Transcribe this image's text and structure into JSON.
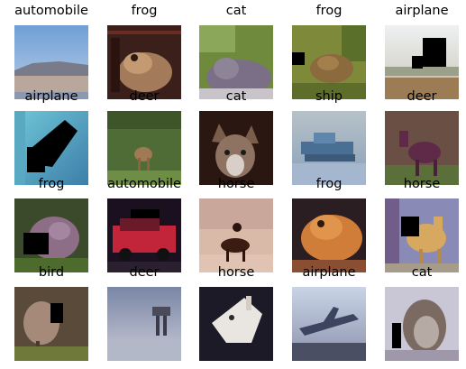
{
  "grid": {
    "rows": 4,
    "cols": 5,
    "images": [
      {
        "label": "automobile",
        "scene": "automobile-1"
      },
      {
        "label": "frog",
        "scene": "frog-1"
      },
      {
        "label": "cat",
        "scene": "cat-1"
      },
      {
        "label": "frog",
        "scene": "frog-2"
      },
      {
        "label": "airplane",
        "scene": "airplane-1"
      },
      {
        "label": "airplane",
        "scene": "airplane-2"
      },
      {
        "label": "deer",
        "scene": "deer-1"
      },
      {
        "label": "cat",
        "scene": "cat-2"
      },
      {
        "label": "ship",
        "scene": "ship-1"
      },
      {
        "label": "deer",
        "scene": "deer-2"
      },
      {
        "label": "frog",
        "scene": "frog-3"
      },
      {
        "label": "automobile",
        "scene": "automobile-2"
      },
      {
        "label": "horse",
        "scene": "horse-1"
      },
      {
        "label": "frog",
        "scene": "frog-4"
      },
      {
        "label": "horse",
        "scene": "horse-2"
      },
      {
        "label": "bird",
        "scene": "bird-1"
      },
      {
        "label": "deer",
        "scene": "deer-3"
      },
      {
        "label": "horse",
        "scene": "horse-3"
      },
      {
        "label": "airplane",
        "scene": "airplane-3"
      },
      {
        "label": "cat",
        "scene": "cat-3"
      }
    ]
  }
}
